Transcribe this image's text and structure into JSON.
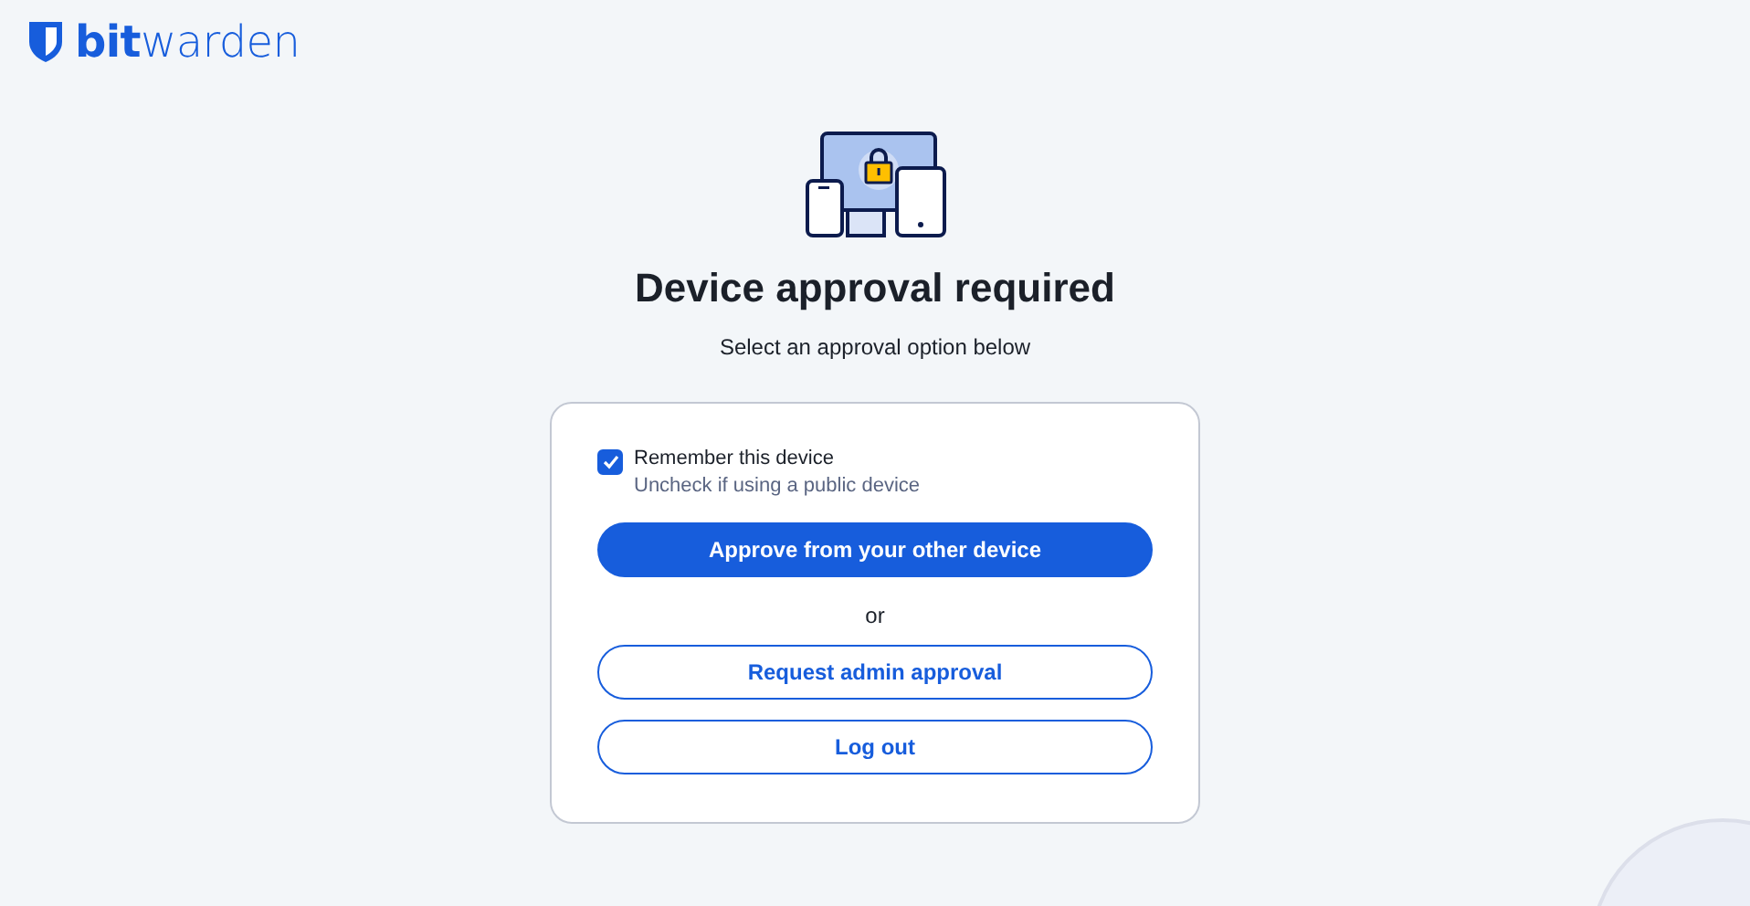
{
  "logo": {
    "text": "**bit**warden"
  },
  "title": "Device approval required",
  "subtitle": "Select an approval option below",
  "remember": {
    "label": "Remember this device",
    "hint": "Uncheck if using a public device",
    "checked": true
  },
  "buttons": [
    {
      "label": "Approve from your other device",
      "kind": "primary"
    },
    {
      "label": "Request admin approval",
      "kind": "secondary"
    },
    {
      "label": "Log out",
      "kind": "secondary"
    }
  ],
  "separator": "or"
}
